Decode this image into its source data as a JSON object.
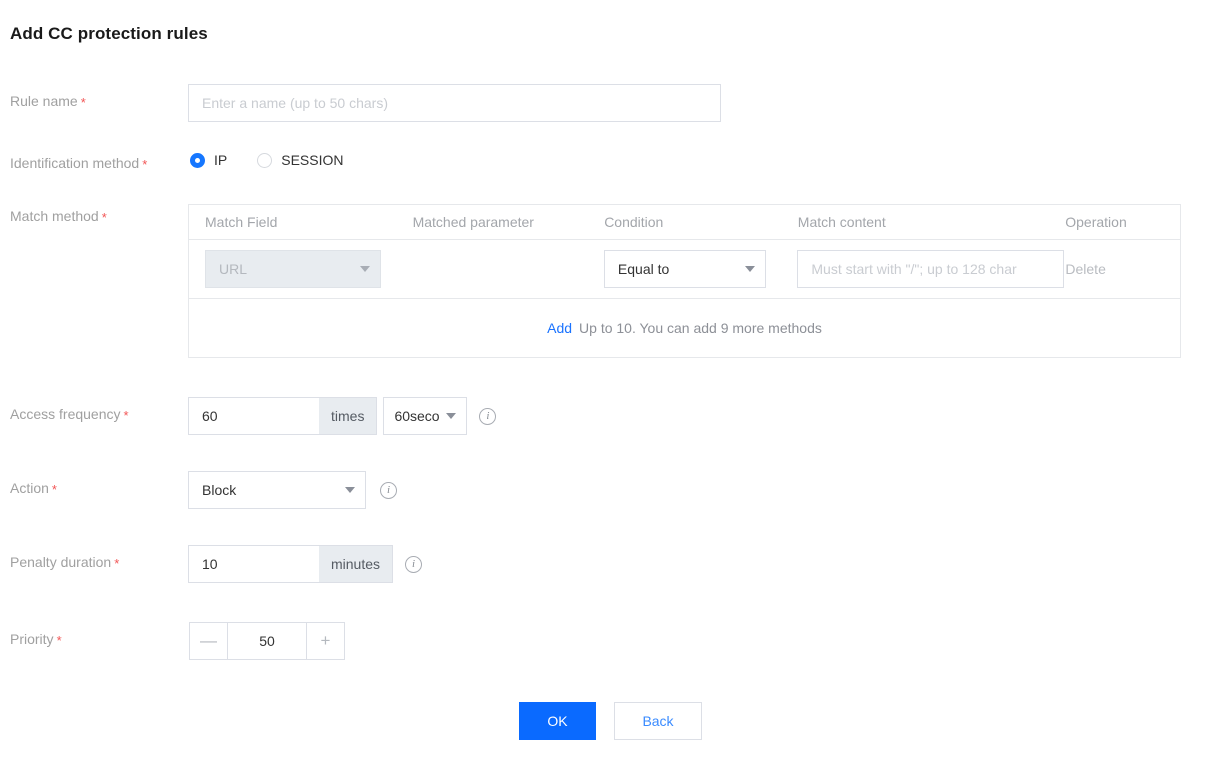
{
  "page": {
    "title": "Add CC protection rules"
  },
  "fields": {
    "rule_name": {
      "label": "Rule name",
      "required_marker": "*",
      "value": "",
      "placeholder": "Enter a name (up to 50 chars)"
    },
    "identification_method": {
      "label": "Identification method",
      "required_marker": "*",
      "selected": "IP",
      "options": [
        {
          "label": "IP",
          "checked": true
        },
        {
          "label": "SESSION",
          "checked": false
        }
      ]
    },
    "match_method": {
      "label": "Match method",
      "required_marker": "*",
      "columns": [
        "Match Field",
        "Matched parameter",
        "Condition",
        "Match content",
        "Operation"
      ],
      "rows": [
        {
          "match_field": "URL",
          "match_field_disabled": true,
          "matched_parameter": "",
          "condition": "Equal to",
          "match_content": "",
          "match_content_placeholder": "Must start with \"/\"; up to 128 char",
          "operation": "Delete"
        }
      ],
      "add_link": "Add",
      "add_hint": "Up to 10. You can add 9 more methods"
    },
    "access_frequency": {
      "label": "Access frequency",
      "required_marker": "*",
      "value": "60",
      "unit": "times",
      "period": "60seco",
      "info_icon": "info-icon"
    },
    "action": {
      "label": "Action",
      "required_marker": "*",
      "value": "Block",
      "info_icon": "info-icon"
    },
    "penalty_duration": {
      "label": "Penalty duration",
      "required_marker": "*",
      "value": "10",
      "unit": "minutes",
      "info_icon": "info-icon"
    },
    "priority": {
      "label": "Priority",
      "required_marker": "*",
      "value": "50",
      "decrease_label": "—",
      "increase_label": "+"
    }
  },
  "footer": {
    "ok_label": "OK",
    "back_label": "Back"
  },
  "colors": {
    "primary": "#0a6aff",
    "link": "#1a73ff",
    "required": "#f25555",
    "radio_checked": "#1677ff"
  }
}
